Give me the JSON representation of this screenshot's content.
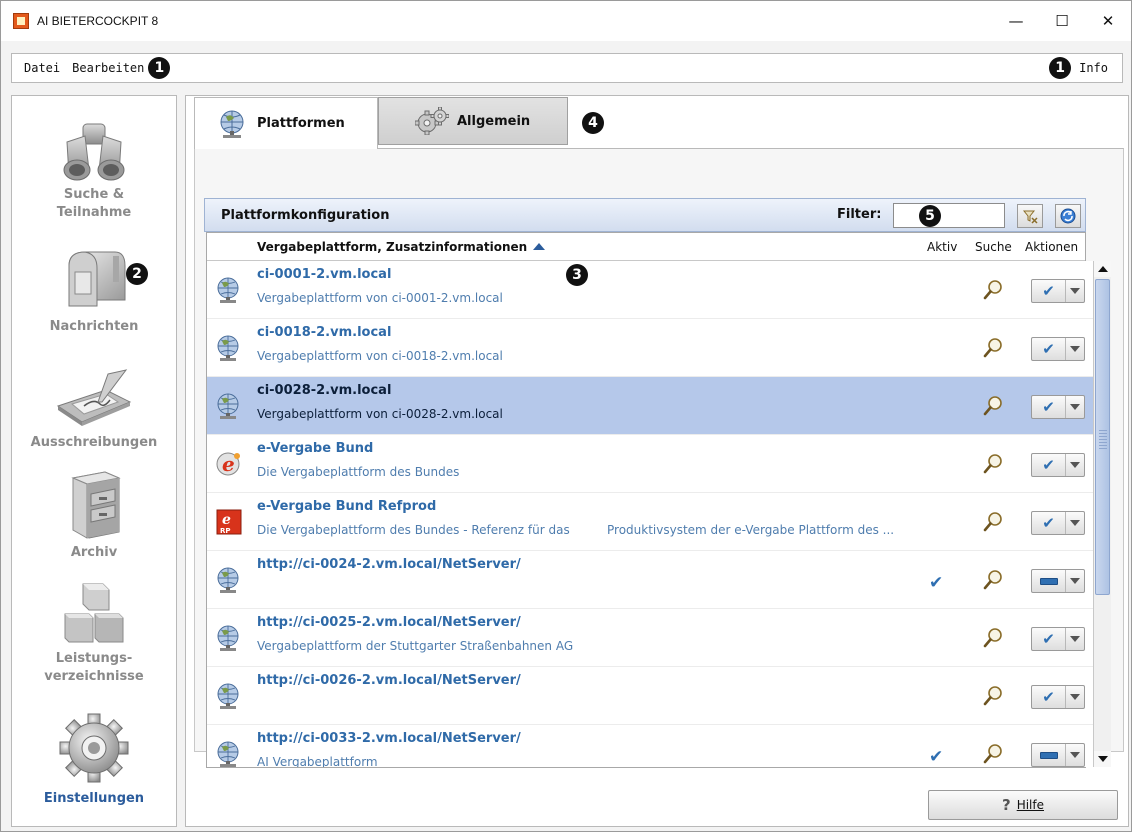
{
  "window": {
    "title": "AI BIETERCOCKPIT 8",
    "minimize": "—",
    "maximize": "☐",
    "close": "✕"
  },
  "menu": {
    "datei": "Datei",
    "bearbeiten": "Bearbeiten",
    "info": "Info"
  },
  "badges": {
    "b1": "1",
    "b2": "2",
    "b3": "3",
    "b4": "4",
    "b5": "5"
  },
  "nav": {
    "items": [
      {
        "label": "Suche & Teilnahme",
        "icon": "binoculars-icon"
      },
      {
        "label": "Nachrichten",
        "icon": "mailbox-icon"
      },
      {
        "label": "Ausschreibungen",
        "icon": "signature-pad-icon"
      },
      {
        "label": "Archiv",
        "icon": "file-cabinet-icon"
      },
      {
        "label": "Leistungs-\nverzeichnisse",
        "icon": "boxes-icon"
      },
      {
        "label": "Einstellungen",
        "icon": "gear-icon",
        "active": true
      }
    ]
  },
  "tabs": {
    "plattformen": "Plattformen",
    "allgemein": "Allgemein"
  },
  "config": {
    "title": "Plattformkonfiguration",
    "filter_label": "Filter:",
    "filter_value": "",
    "columns": {
      "main": "Vergabeplattform, Zusatzinformationen",
      "aktiv": "Aktiv",
      "suche": "Suche",
      "aktionen": "Aktionen"
    },
    "rows": [
      {
        "title": "ci-0001-2.vm.local",
        "sub": "Vergabeplattform von ci-0001-2.vm.local",
        "sub2": "",
        "icon": "globe-icon",
        "aktiv": false,
        "action": "check",
        "selected": false
      },
      {
        "title": "ci-0018-2.vm.local",
        "sub": "Vergabeplattform von ci-0018-2.vm.local",
        "sub2": "",
        "icon": "globe-icon",
        "aktiv": false,
        "action": "check",
        "selected": false
      },
      {
        "title": "ci-0028-2.vm.local",
        "sub": "Vergabeplattform von ci-0028-2.vm.local",
        "sub2": "",
        "icon": "globe-icon",
        "aktiv": false,
        "action": "check",
        "selected": true
      },
      {
        "title": "e-Vergabe Bund",
        "sub": "Die Vergabeplattform des Bundes",
        "sub2": "",
        "icon": "e-vergabe-icon",
        "aktiv": false,
        "action": "check",
        "selected": false
      },
      {
        "title": "e-Vergabe Bund Refprod",
        "sub": "Die Vergabeplattform des Bundes - Referenz für das",
        "sub2": "Produktivsystem der e-Vergabe Plattform des ...",
        "icon": "e-vergabe-rp-icon",
        "aktiv": false,
        "action": "check",
        "selected": false
      },
      {
        "title": "http://ci-0024-2.vm.local/NetServer/",
        "sub": "",
        "sub2": "",
        "icon": "globe-icon",
        "aktiv": true,
        "action": "minus",
        "selected": false
      },
      {
        "title": "http://ci-0025-2.vm.local/NetServer/",
        "sub": "Vergabeplattform der Stuttgarter Straßenbahnen AG",
        "sub2": "",
        "icon": "globe-icon",
        "aktiv": false,
        "action": "check",
        "selected": false
      },
      {
        "title": "http://ci-0026-2.vm.local/NetServer/",
        "sub": "",
        "sub2": "",
        "icon": "globe-icon",
        "aktiv": false,
        "action": "check",
        "selected": false
      },
      {
        "title": "http://ci-0033-2.vm.local/NetServer/",
        "sub": "AI Vergabeplattform",
        "sub2": "",
        "icon": "globe-icon",
        "aktiv": true,
        "action": "minus",
        "selected": false
      }
    ]
  },
  "help": {
    "label": "Hilfe",
    "icon": "?"
  },
  "icons": {
    "check": "✔",
    "magnifier": "magnifier-icon"
  },
  "colors": {
    "accent": "#2f6aa8",
    "selected_row": "#b5c8ea",
    "header_gradient_top": "#eef3fb",
    "header_gradient_bottom": "#d2ddef"
  }
}
